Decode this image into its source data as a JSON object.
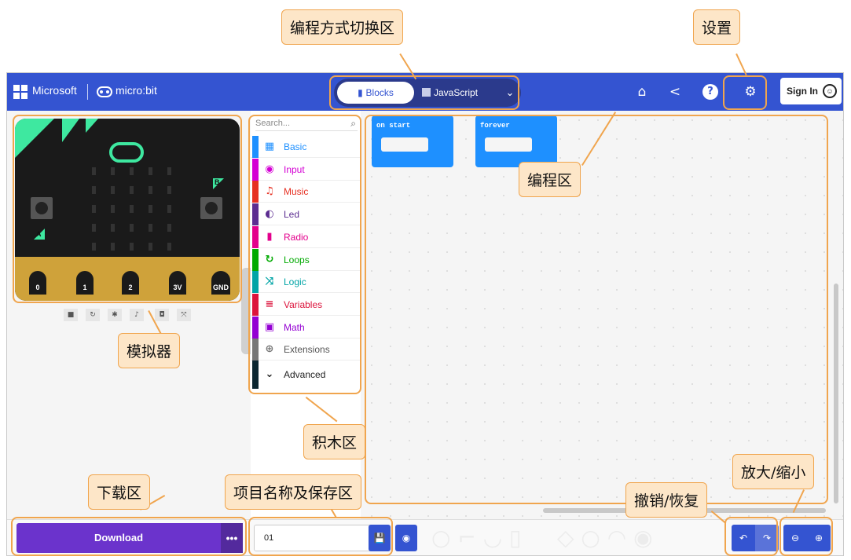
{
  "header": {
    "ms_brand": "Microsoft",
    "separator": "|",
    "mb_brand": "micro:bit",
    "tabs": {
      "blocks": "Blocks",
      "javascript": "JavaScript"
    },
    "signin_label": "Sign In"
  },
  "icons": {
    "home": "home-icon",
    "share": "share-icon",
    "help": "help-icon",
    "settings": "gear-icon"
  },
  "simulator": {
    "pins": [
      "0",
      "1",
      "2",
      "3V",
      "GND"
    ],
    "button_a": "A",
    "button_b": "B"
  },
  "toolbox": {
    "search_placeholder": "Search...",
    "categories": [
      {
        "label": "Basic",
        "color": "#1e90ff"
      },
      {
        "label": "Input",
        "color": "#d400d4"
      },
      {
        "label": "Music",
        "color": "#e63022"
      },
      {
        "label": "Led",
        "color": "#5c2d91"
      },
      {
        "label": "Radio",
        "color": "#e3008c"
      },
      {
        "label": "Loops",
        "color": "#00aa00"
      },
      {
        "label": "Logic",
        "color": "#00a4a6"
      },
      {
        "label": "Variables",
        "color": "#dc143c"
      },
      {
        "label": "Math",
        "color": "#9400d3"
      },
      {
        "label": "Extensions",
        "color": "#777777"
      }
    ],
    "advanced": "Advanced"
  },
  "workspace": {
    "block_on_start": "on start",
    "block_forever": "forever"
  },
  "bottom": {
    "download_label": "Download",
    "more": "•••",
    "project_name": "01"
  },
  "annotations": {
    "mode_switch": "编程方式切换区",
    "settings": "设置",
    "coding_area": "编程区",
    "simulator": "模拟器",
    "blocks_area": "积木区",
    "download_area": "下载区",
    "project_area": "项目名称及保存区",
    "undo_redo": "撤销/恢复",
    "zoom": "放大/缩小"
  },
  "colors": {
    "header_bg": "#3454d1",
    "download_bg": "#6b33cc",
    "callout_bg": "#fde6c8",
    "callout_border": "#f0a54e",
    "block_blue": "#1e90ff"
  }
}
